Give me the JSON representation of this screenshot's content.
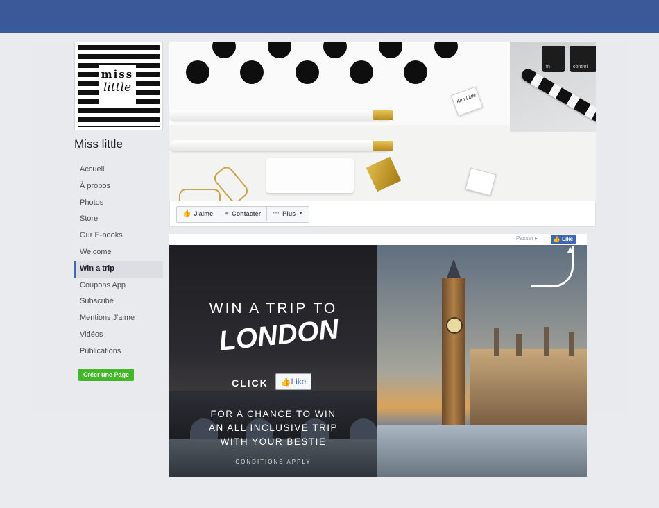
{
  "page": {
    "name": "Miss little",
    "logo": {
      "line1": "miss",
      "line2": "little"
    }
  },
  "nav": {
    "items": [
      {
        "label": "Accueil"
      },
      {
        "label": "À propos"
      },
      {
        "label": "Photos"
      },
      {
        "label": "Store"
      },
      {
        "label": "Our E-books"
      },
      {
        "label": "Welcome"
      },
      {
        "label": "Win a trip",
        "active": true
      },
      {
        "label": "Coupons App"
      },
      {
        "label": "Subscribe"
      },
      {
        "label": "Mentions J'aime"
      },
      {
        "label": "Vidéos"
      },
      {
        "label": "Publications"
      }
    ],
    "create_page": "Créer une Page"
  },
  "cover": {
    "keys": [
      "fn",
      "control"
    ],
    "binder_text": "Ann Little"
  },
  "actions": {
    "like": "J'aime",
    "contact": "Contacter",
    "more": "Plus"
  },
  "promo": {
    "skip": "Passer ▸",
    "like_small": "Like",
    "title": "WIN A TRIP TO",
    "city": "LONDON",
    "click": "CLICK",
    "like_big": "Like",
    "body_line1": "FOR A CHANCE TO WIN",
    "body_line2": "AN ALL INCLUSIVE TRIP",
    "body_line3": "WITH YOUR BESTIE",
    "conditions": "CONDITIONS APPLY"
  },
  "colors": {
    "topbar": "#3b5998",
    "accent": "#4267b2",
    "create_button": "#42b72a",
    "background": "#e9ebee"
  },
  "icons": [
    "thumbs-up-icon",
    "messenger-icon",
    "more-dots-icon",
    "chevron-down-icon",
    "curved-arrow-icon"
  ]
}
